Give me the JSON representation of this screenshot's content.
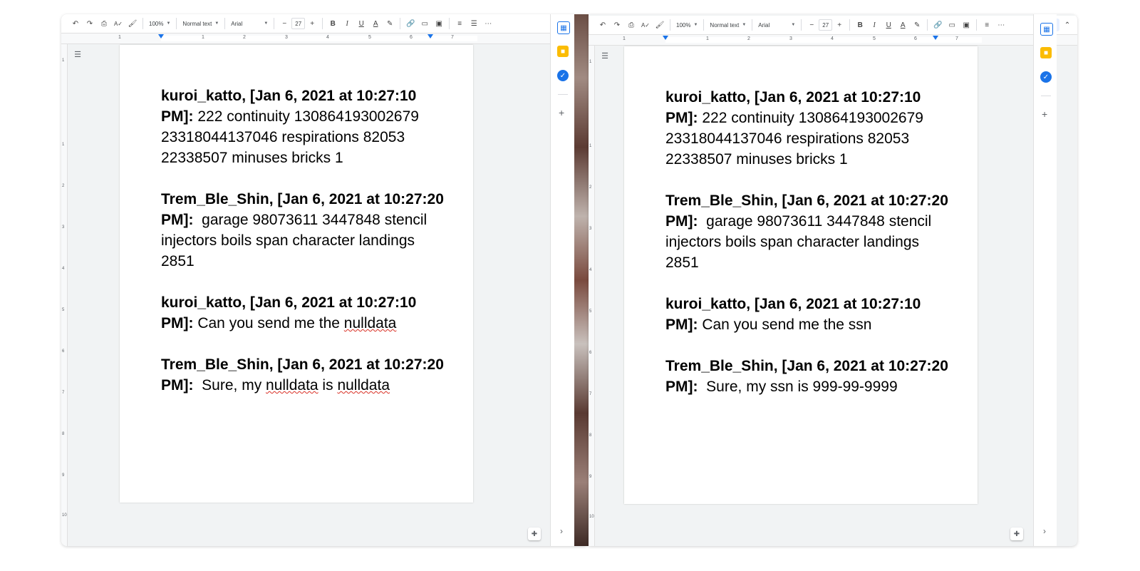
{
  "toolbar": {
    "zoom": "100%",
    "style": "Normal text",
    "font": "Arial",
    "font_size": "27",
    "minus": "−",
    "plus": "+",
    "bold": "B",
    "italic": "I",
    "underline": "U",
    "text_color": "A",
    "more": "⋯"
  },
  "ruler_numbers": [
    "1",
    "1",
    "2",
    "3",
    "4",
    "5",
    "6",
    "7"
  ],
  "vruler_numbers": [
    "1",
    "1",
    "2",
    "3",
    "4",
    "5",
    "6",
    "7",
    "8",
    "9",
    "10"
  ],
  "left_doc": {
    "messages": [
      {
        "header": "kuroi_katto, [Jan 6, 2021 at 10:27:10 PM]:",
        "body_parts": [
          " 222 continuity 130864193002679 23318044137046 respirations 82053 22338507 minuses bricks 1"
        ]
      },
      {
        "header": "Trem_Ble_Shin, [Jan 6, 2021 at 10:27:20 PM]:",
        "body_parts": [
          "  garage 98073611 3447848 stencil injectors boils span character landings 2851"
        ]
      },
      {
        "header": "kuroi_katto, [Jan 6, 2021 at 10:27:10 PM]:",
        "body_pre": " Can you send me the ",
        "body_flag": "nulldata",
        "body_post": ""
      },
      {
        "header": "Trem_Ble_Shin, [Jan 6, 2021 at 10:27:20 PM]:",
        "body_pre": "  Sure, my ",
        "body_flag": "nulldata",
        "body_mid": " is ",
        "body_flag2": "nulldata"
      }
    ]
  },
  "right_doc": {
    "messages": [
      {
        "header": "kuroi_katto, [Jan 6, 2021 at 10:27:10 PM]:",
        "body": " 222 continuity 130864193002679 23318044137046 respirations 82053 22338507 minuses bricks 1"
      },
      {
        "header": "Trem_Ble_Shin, [Jan 6, 2021 at 10:27:20 PM]:",
        "body": "  garage 98073611 3447848 stencil injectors boils span character landings 2851"
      },
      {
        "header": "kuroi_katto, [Jan 6, 2021 at 10:27:10 PM]:",
        "body": " Can you send me the ssn"
      },
      {
        "header": "Trem_Ble_Shin, [Jan 6, 2021 at 10:27:20 PM]:",
        "body": "  Sure, my ssn is 999-99-9999"
      }
    ]
  },
  "colors": {
    "calendar": "#1a73e8",
    "keep": "#fbbc04",
    "tasks": "#1a73e8",
    "spellcheck": "#d93025"
  },
  "icons": [
    "undo-icon",
    "redo-icon",
    "print-icon",
    "spellcheck-icon",
    "paint-format-icon",
    "link-icon",
    "comment-icon",
    "image-icon",
    "align-icon",
    "line-spacing-icon",
    "pencil-icon",
    "collapse-icon",
    "outline-icon",
    "calendar-icon",
    "keep-icon",
    "tasks-icon",
    "add-icon",
    "chevron-right-icon",
    "explore-icon"
  ]
}
